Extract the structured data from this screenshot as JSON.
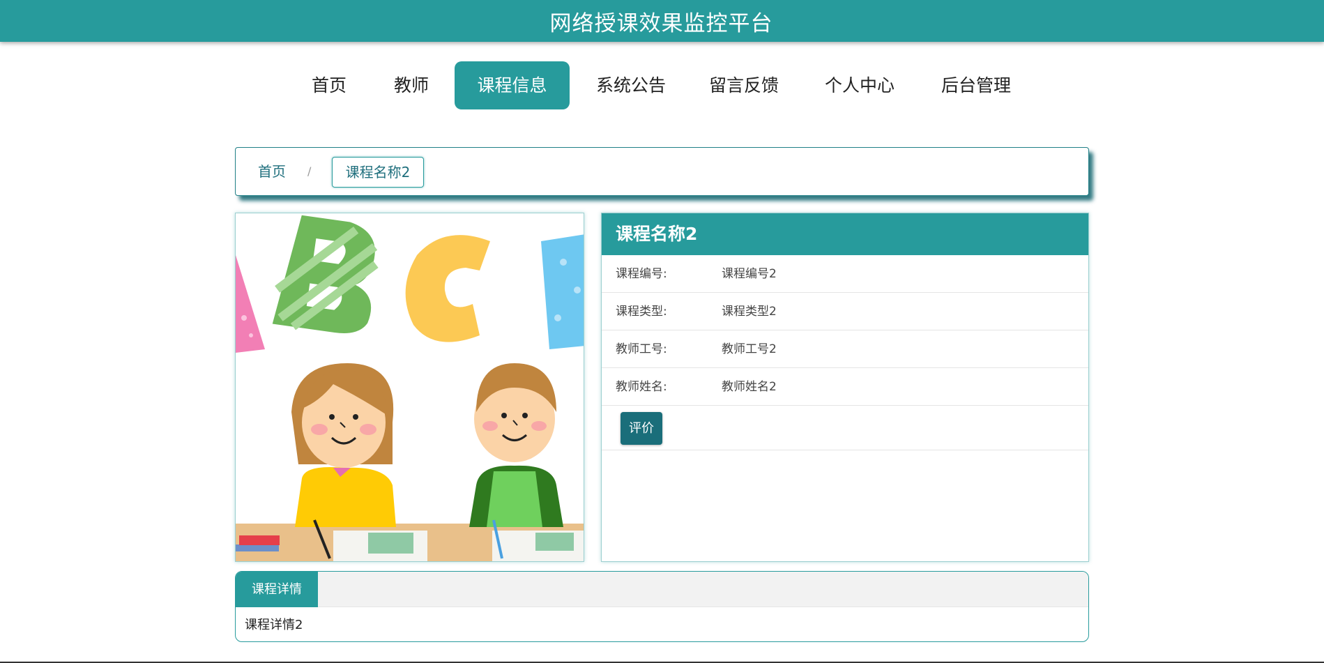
{
  "header": {
    "title": "网络授课效果监控平台"
  },
  "nav": {
    "items": [
      {
        "label": "首页",
        "active": false
      },
      {
        "label": "教师",
        "active": false
      },
      {
        "label": "课程信息",
        "active": true
      },
      {
        "label": "系统公告",
        "active": false
      },
      {
        "label": "留言反馈",
        "active": false
      },
      {
        "label": "个人中心",
        "active": false
      },
      {
        "label": "后台管理",
        "active": false
      }
    ]
  },
  "breadcrumb": {
    "home": "首页",
    "separator": "/",
    "current": "课程名称2"
  },
  "course": {
    "name": "课程名称2",
    "fields": [
      {
        "label": "课程编号:",
        "value": "课程编号2"
      },
      {
        "label": "课程类型:",
        "value": "课程类型2"
      },
      {
        "label": "教师工号:",
        "value": "教师工号2"
      },
      {
        "label": "教师姓名:",
        "value": "教师姓名2"
      }
    ],
    "rate_button": "评价",
    "image_alt": "children-reading-illustration"
  },
  "detail": {
    "tab_label": "课程详情",
    "content": "课程详情2"
  },
  "colors": {
    "primary": "#279b9c",
    "dark_teal": "#1a6e7a"
  }
}
